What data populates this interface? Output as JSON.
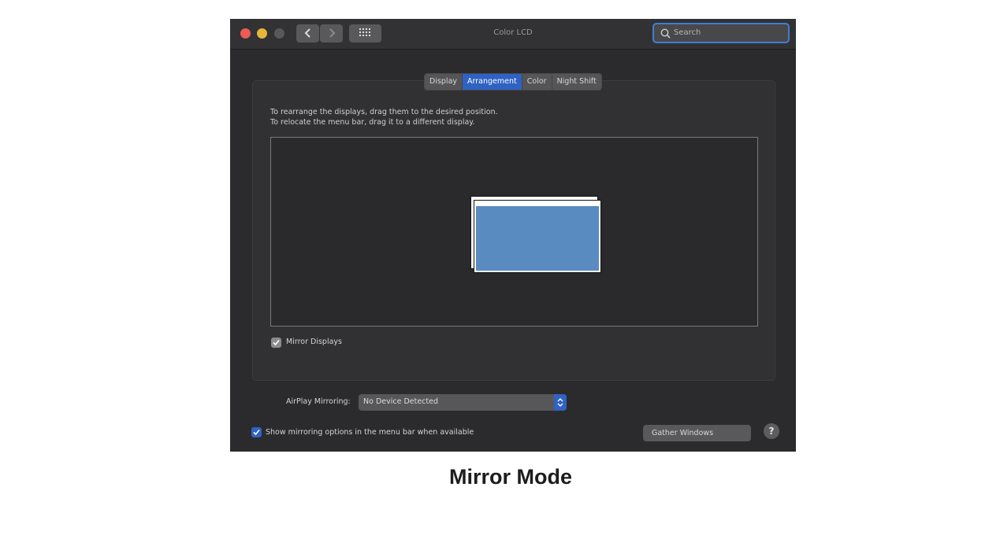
{
  "window": {
    "title": "Color LCD",
    "search_placeholder": "Search",
    "nav": {
      "back_icon": "chevron-left-icon",
      "forward_icon": "chevron-right-icon",
      "grid_icon": "grid-icon"
    }
  },
  "tabs": [
    {
      "label": "Display",
      "active": false
    },
    {
      "label": "Arrangement",
      "active": true
    },
    {
      "label": "Color",
      "active": false
    },
    {
      "label": "Night Shift",
      "active": false
    }
  ],
  "arrangement": {
    "instruction_line1": "To rearrange the displays, drag them to the desired position.",
    "instruction_line2": "To relocate the menu bar, drag it to a different display.",
    "mirror_displays_label": "Mirror Displays",
    "mirror_displays_checked": true
  },
  "airplay": {
    "label": "AirPlay Mirroring:",
    "value": "No Device Detected"
  },
  "show_mirroring": {
    "label": "Show mirroring options in the menu bar when available",
    "checked": true
  },
  "gather_windows_label": "Gather Windows",
  "help_label": "?",
  "caption": "Mirror Mode",
  "colors": {
    "accent": "#2f62c3",
    "display": "#5a8bc0",
    "background": "#2b2b2d"
  }
}
